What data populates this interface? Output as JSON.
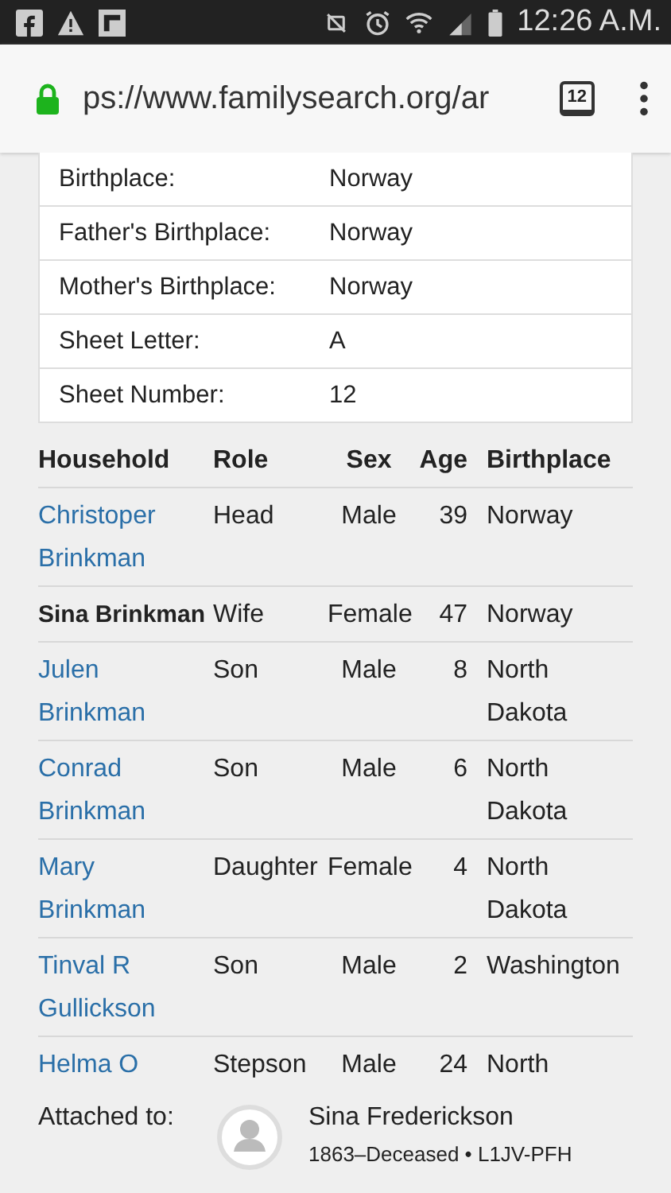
{
  "status_bar": {
    "time": "12:26 A.M."
  },
  "browser": {
    "url": "ps://www.familysearch.org/ar",
    "tab_count": "12"
  },
  "facts": [
    {
      "label": "Birthplace:",
      "value": "Norway"
    },
    {
      "label": "Father's Birthplace:",
      "value": "Norway"
    },
    {
      "label": "Mother's Birthplace:",
      "value": "Norway"
    },
    {
      "label": "Sheet Letter:",
      "value": "A"
    },
    {
      "label": "Sheet Number:",
      "value": "12"
    }
  ],
  "household": {
    "columns": [
      "Household",
      "Role",
      "Sex",
      "Age",
      "Birthplace"
    ],
    "rows": [
      {
        "name": "Christoper Brinkman",
        "linked": true,
        "role": "Head",
        "sex": "Male",
        "age": "39",
        "birthplace": "Norway"
      },
      {
        "name": "Sina Brinkman",
        "linked": false,
        "role": "Wife",
        "sex": "Female",
        "age": "47",
        "birthplace": "Norway"
      },
      {
        "name": "Julen Brinkman",
        "linked": true,
        "role": "Son",
        "sex": "Male",
        "age": "8",
        "birthplace": "North Dakota"
      },
      {
        "name": "Conrad Brinkman",
        "linked": true,
        "role": "Son",
        "sex": "Male",
        "age": "6",
        "birthplace": "North Dakota"
      },
      {
        "name": "Mary Brinkman",
        "linked": true,
        "role": "Daughter",
        "sex": "Female",
        "age": "4",
        "birthplace": "North Dakota"
      },
      {
        "name": "Tinval R Gullickson",
        "linked": true,
        "role": "Son",
        "sex": "Male",
        "age": "2",
        "birthplace": "Washington"
      },
      {
        "name": "Helma O",
        "linked": true,
        "role": "Stepson",
        "sex": "Male",
        "age": "24",
        "birthplace": "North"
      }
    ]
  },
  "attached": {
    "label": "Attached to:",
    "name": "Sina Frederickson",
    "details": "1863–Deceased • L1JV-PFH"
  }
}
